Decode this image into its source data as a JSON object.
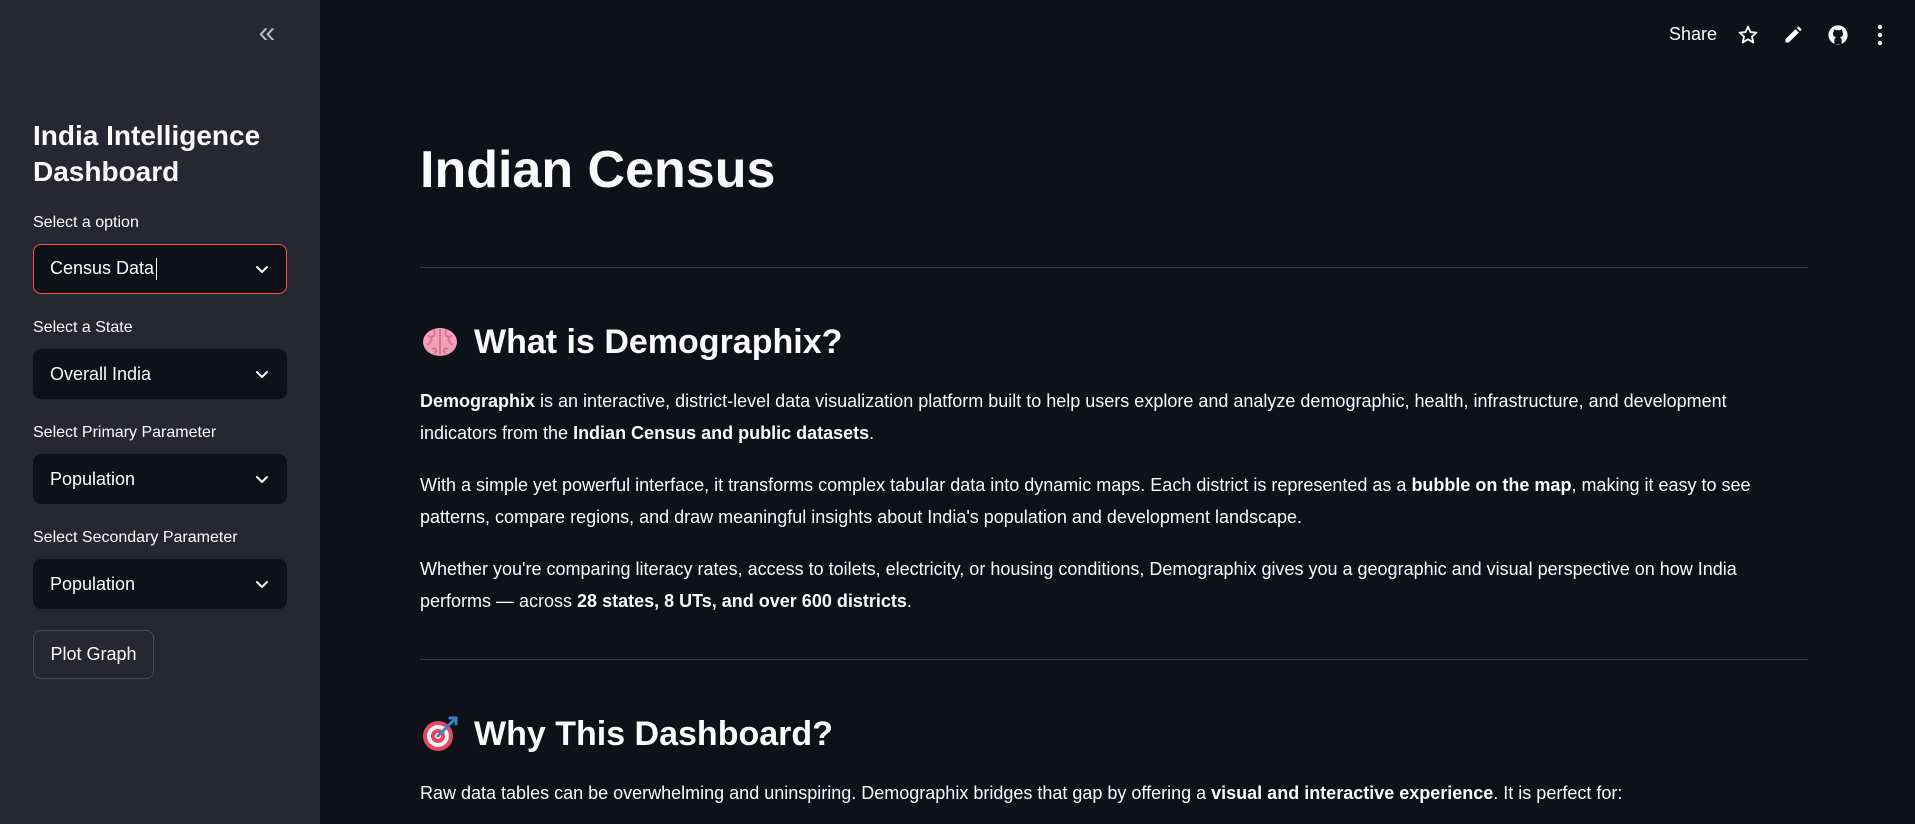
{
  "sidebar": {
    "collapse_icon": "double-chevron-left-icon",
    "title": "India Intelligence Dashboard",
    "option": {
      "label": "Select a option",
      "value": "Census Data"
    },
    "state": {
      "label": "Select a State",
      "value": "Overall India"
    },
    "primary": {
      "label": "Select Primary Parameter",
      "value": "Population"
    },
    "secondary": {
      "label": "Select Secondary Parameter",
      "value": "Population"
    },
    "plot_button": "Plot Graph"
  },
  "topbar": {
    "share": "Share",
    "icons": [
      "star-icon",
      "edit-pencil-icon",
      "github-icon",
      "more-vertical-icon"
    ]
  },
  "main": {
    "title": "Indian Census",
    "section1": {
      "emoji": "brain-icon",
      "heading": "What is Demographix?",
      "p1": {
        "b1": "Demographix",
        "t1": " is an interactive, district-level data visualization platform built to help users explore and analyze demographic, health, infrastructure, and development indicators from the ",
        "b2": "Indian Census and public datasets",
        "t2": "."
      },
      "p2": {
        "t1": "With a simple yet powerful interface, it transforms complex tabular data into dynamic maps. Each district is represented as a ",
        "b1": "bubble on the map",
        "t2": ", making it easy to see patterns, compare regions, and draw meaningful insights about India's population and development landscape."
      },
      "p3": {
        "t1": "Whether you're comparing literacy rates, access to toilets, electricity, or housing conditions, Demographix gives you a geographic and visual perspective on how India performs — across ",
        "b1": "28 states, 8 UTs, and over 600 districts",
        "t2": "."
      }
    },
    "section2": {
      "emoji": "target-icon",
      "heading": "Why This Dashboard?",
      "p1": {
        "t1": "Raw data tables can be overwhelming and uninspiring. Demographix bridges that gap by offering a ",
        "b1": "visual and interactive experience",
        "t2": ". It is perfect for:"
      }
    }
  },
  "colors": {
    "background": "#0e1117",
    "sidebar": "#262730",
    "focus_border": "#ff4b4b"
  }
}
